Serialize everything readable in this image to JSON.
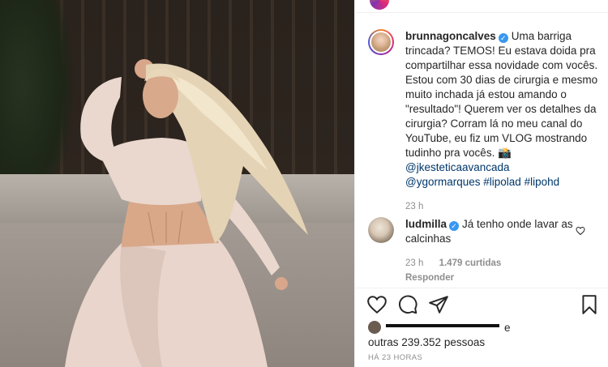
{
  "post": {
    "author": {
      "username": "brunnagoncalves",
      "verified": true,
      "caption_text": "Uma barriga trincada? TEMOS! Eu estava doida pra compartilhar essa novidade com vocês. Estou com 30 dias de cirurgia e mesmo muito inchada já estou amando o \"resultado\"! Querem ver os detalhes da cirurgia? Corram lá no meu canal do YouTube, eu fiz um VLOG mostrando tudinho pra vocês.",
      "caption_emoji": "📸",
      "mentions_line1": "@jkesteticaavancada",
      "mentions_line2": "@ygormarques",
      "hashtag_1": "#lipolad",
      "hashtag_2": "#lipohd",
      "time": "23 h"
    },
    "comment": {
      "username": "ludmilla",
      "verified": true,
      "text": "Já tenho onde lavar as calcinhas",
      "time": "23 h",
      "likes": "1.479 curtidas",
      "reply_label": "Responder"
    },
    "likes": {
      "suffix_e": "e",
      "others": "outras 239.352 pessoas"
    },
    "posted_ago": "HÁ 23 HORAS"
  },
  "icons": {
    "like": "heart-icon",
    "comment": "comment-icon",
    "share": "paper-plane-icon",
    "save": "bookmark-icon",
    "comment_like": "heart-icon",
    "verified": "verified-badge-icon"
  },
  "colors": {
    "verified_blue": "#3897f0",
    "link_blue": "#00376b",
    "muted_text": "#8e8e8e",
    "text": "#262626"
  }
}
